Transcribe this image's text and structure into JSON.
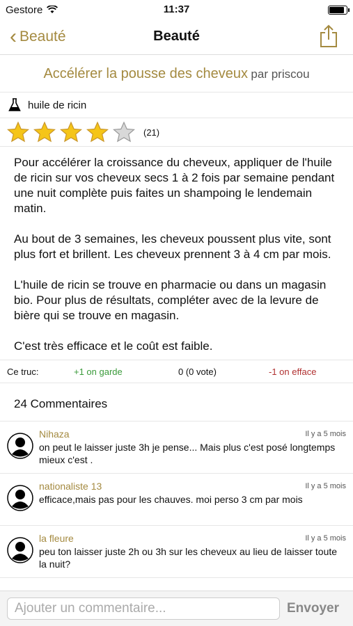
{
  "status": {
    "carrier": "Gestore",
    "time": "11:37",
    "battery_level": 0.95
  },
  "nav": {
    "back_label": "Beauté",
    "title": "Beauté"
  },
  "tip": {
    "title": "Accélérer la pousse des cheveux",
    "by": "par priscou",
    "ingredient": "huile de ricin",
    "rating": 4,
    "rating_max": 5,
    "rating_count": "(21)",
    "paragraphs": [
      "Pour accélérer la croissance du cheveux, appliquer de l'huile de ricin sur vos cheveux secs 1 à 2 fois par semaine pendant une nuit complète puis faites un shampoing le lendemain matin.",
      "Au bout de 3 semaines, les cheveux poussent plus vite, sont plus fort et brillent. Les cheveux prennent 3 à 4 cm par mois.",
      "L'huile de ricin se trouve en pharmacie ou dans un magasin bio. Pour plus de résultats, compléter avec de la levure de bière qui se trouve en magasin.",
      "C'est très efficace et le coût est faible."
    ]
  },
  "vote": {
    "label": "Ce truc:",
    "keep": "+1 on garde",
    "count": "0 (0 vote)",
    "remove": "-1 on efface"
  },
  "comments_header": "24 Commentaires",
  "comments": [
    {
      "author": "Nihaza",
      "time": "Il y a 5 mois",
      "text": "on peut le laisser juste 3h je pense... Mais plus c'est posé longtemps mieux c'est ."
    },
    {
      "author": "nationaliste 13",
      "time": "Il y a 5 mois",
      "text": "efficace,mais pas pour les chauves. moi perso 3 cm par mois"
    },
    {
      "author": "la fleure",
      "time": "Il y a 5 mois",
      "text": "peu ton laisser juste 2h ou 3h sur les cheveux au lieu de laisser toute la nuit?"
    }
  ],
  "composer": {
    "placeholder": "Ajouter un commentaire...",
    "send_label": "Envoyer"
  },
  "colors": {
    "accent": "#a48a40",
    "star": "#f5c518",
    "up": "#3a9a3a",
    "down": "#b03030"
  }
}
